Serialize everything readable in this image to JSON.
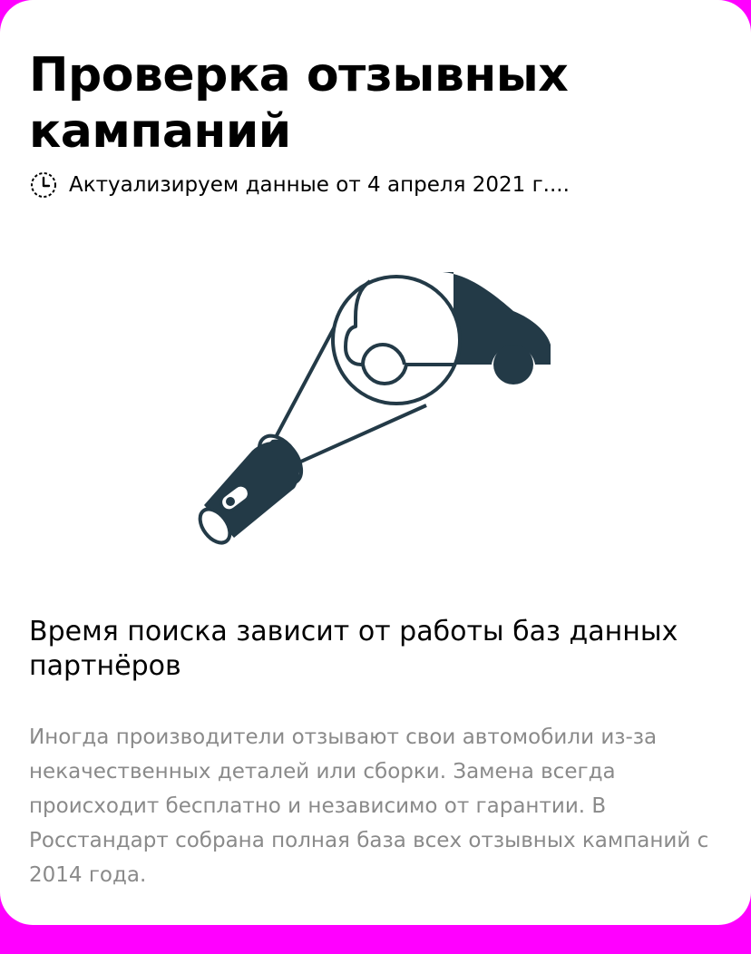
{
  "header": {
    "title": "Проверка отзывных кампаний",
    "status_icon": "clock-icon",
    "status_text": "Актуализируем данные от 4 апреля 2021 г...."
  },
  "illustration": {
    "icon": "flashlight-car-icon",
    "color": "#233a47"
  },
  "content": {
    "subtitle": "Время поиска зависит от работы баз данных партнёров",
    "description": "Иногда производители отзывают свои автомобили из-за некачественных деталей или сборки. Замена всегда происходит бесплатно и независимо от гарантии. В Росстандарт собрана полная база всех отзывных кампаний с 2014 года."
  },
  "colors": {
    "background": "#ff00ff",
    "card": "#ffffff",
    "text": "#000000",
    "muted_text": "#8a8a8a",
    "illustration": "#233a47"
  }
}
